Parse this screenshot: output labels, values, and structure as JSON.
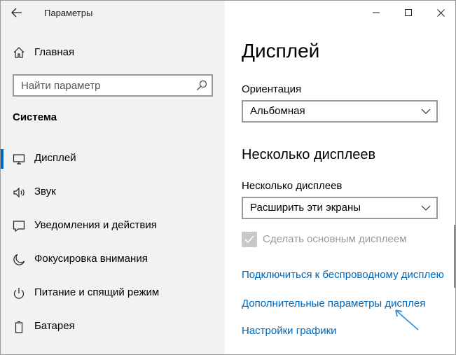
{
  "window": {
    "title": "Параметры"
  },
  "sidebar": {
    "home_label": "Главная",
    "search_placeholder": "Найти параметр",
    "section_title": "Система",
    "items": [
      {
        "label": "Дисплей",
        "icon": "monitor-icon",
        "active": true
      },
      {
        "label": "Звук",
        "icon": "speaker-icon",
        "active": false
      },
      {
        "label": "Уведомления и действия",
        "icon": "notification-icon",
        "active": false
      },
      {
        "label": "Фокусировка внимания",
        "icon": "moon-icon",
        "active": false
      },
      {
        "label": "Питание и спящий режим",
        "icon": "power-icon",
        "active": false
      },
      {
        "label": "Батарея",
        "icon": "battery-icon",
        "active": false
      }
    ]
  },
  "main": {
    "title": "Дисплей",
    "orientation": {
      "label": "Ориентация",
      "value": "Альбомная"
    },
    "multi_display": {
      "section_title": "Несколько дисплеев",
      "label": "Несколько дисплеев",
      "value": "Расширить эти экраны"
    },
    "main_display_checkbox": {
      "label": "Сделать основным дисплеем",
      "checked": true,
      "disabled": true
    },
    "links": {
      "wireless": "Подключиться к беспроводному дисплею",
      "advanced": "Дополнительные параметры дисплея",
      "graphics": "Настройки графики"
    }
  },
  "colors": {
    "accent": "#0067c0",
    "link": "#0067b8",
    "sidebar_bg": "#f2f2f2",
    "annotation": "#3a8fd8"
  }
}
